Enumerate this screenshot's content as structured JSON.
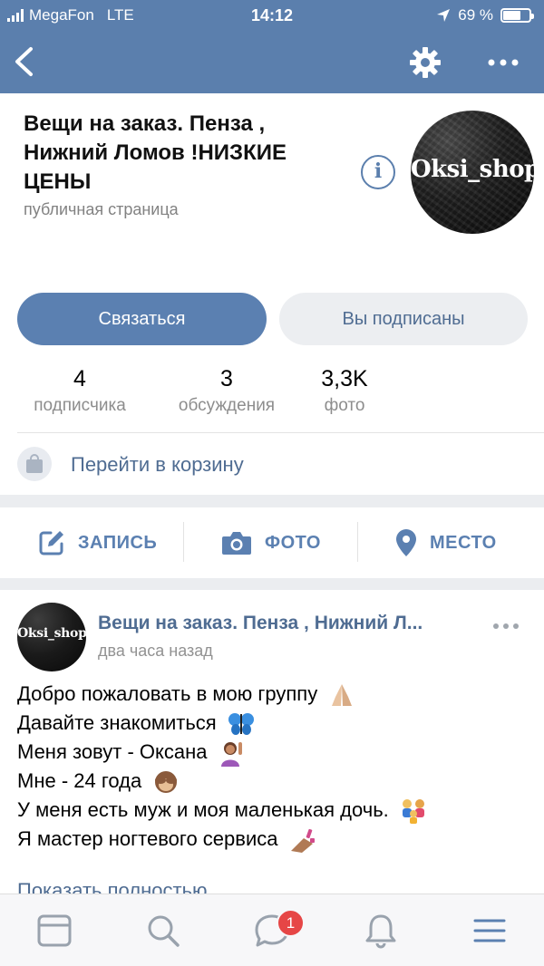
{
  "status_bar": {
    "carrier": "MegaFon",
    "network": "LTE",
    "time": "14:12",
    "battery": "69 %",
    "battery_level": 0.69
  },
  "colors": {
    "header": "#5b7fad",
    "accent": "#5b80b1",
    "link": "#4f6c92",
    "badge": "#e64646"
  },
  "nav": {
    "back_icon": "chevron-left-icon",
    "settings_icon": "gear-icon",
    "more_icon": "more-horizontal-icon"
  },
  "community": {
    "title": "Вещи на заказ. Пенза , Нижний Ломов !НИЗКИЕ ЦЕНЫ",
    "type": "публичная страница",
    "avatar_text": "Oksi_shop",
    "info_icon": "info-icon"
  },
  "buttons": {
    "contact": "Связаться",
    "subscribed": "Вы подписаны"
  },
  "counters": [
    {
      "value": "4",
      "label": "подписчика"
    },
    {
      "value": "3",
      "label": "обсуждения"
    },
    {
      "value": "3,3K",
      "label": "фото"
    }
  ],
  "cart": {
    "label": "Перейти в корзину"
  },
  "actions": [
    {
      "label": "ЗАПИСЬ",
      "icon": "edit-icon"
    },
    {
      "label": "ФОТО",
      "icon": "camera-icon"
    },
    {
      "label": "МЕСТО",
      "icon": "location-pin-icon"
    }
  ],
  "post": {
    "author": "Вещи на заказ. Пенза , Нижний Л...",
    "time": "два часа назад",
    "avatar_text": "Oksi_shop",
    "lines": [
      {
        "text": "Добро пожаловать в мою группу",
        "emoji": "folded-hands"
      },
      {
        "text": "Давайте знакомиться",
        "emoji": "butterfly"
      },
      {
        "text": "Меня зовут - Оксана",
        "emoji": "woman-raising-hand"
      },
      {
        "text": "Мне - 24 года",
        "emoji": "see-no-evil-monkey"
      },
      {
        "text": "У меня есть муж и моя маленькая дочь.",
        "emoji": "family"
      },
      {
        "text": "Я мастер ногтевого сервиса",
        "emoji": "nail-polish"
      }
    ],
    "show_more": "Показать полностью"
  },
  "tabbar": {
    "items": [
      "news-icon",
      "search-icon",
      "messages-icon",
      "notifications-icon",
      "menu-icon"
    ],
    "messages_badge": "1"
  }
}
